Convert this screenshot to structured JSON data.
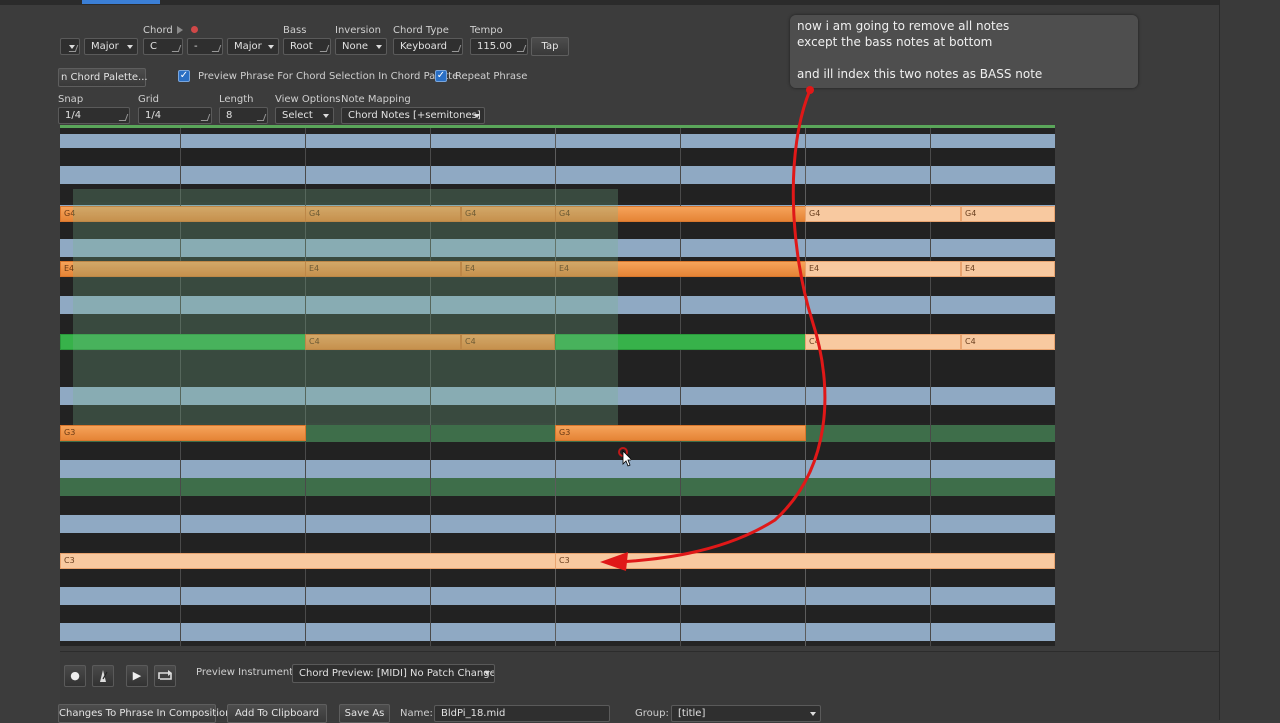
{
  "toolbar": {
    "scale_value": "Major",
    "chord_label": "Chord",
    "chord_value": "C",
    "chord_mod": "-",
    "chord_quality": "Major",
    "bass_label": "Bass",
    "bass_value": "Root",
    "inversion_label": "Inversion",
    "inversion_value": "None",
    "chordtype_label": "Chord Type",
    "chordtype_value": "Keyboard",
    "tempo_label": "Tempo",
    "tempo_value": "115.00",
    "tap_label": "Tap"
  },
  "options": {
    "chord_palette_button": "n Chord Palette...",
    "preview_phrase_label": "Preview Phrase For Chord Selection In Chord Palette",
    "repeat_phrase_label": "Repeat Phrase",
    "check_mark": "✓"
  },
  "grid_controls": {
    "snap_label": "Snap",
    "snap_value": "1/4",
    "grid_label": "Grid",
    "grid_value": "1/4",
    "length_label": "Length",
    "length_value": "8",
    "view_label": "View Options",
    "view_value": "Select",
    "mapping_label": "Note Mapping",
    "mapping_value": "Chord Notes [+semitones]"
  },
  "notes": {
    "g4": "G4",
    "e4": "E4",
    "c4": "C4",
    "g3": "G3",
    "c3": "C3"
  },
  "annotation": {
    "line1": "now i am going to remove all notes",
    "line2": "except the bass notes at bottom",
    "line3": "and ill index this two notes as BASS note"
  },
  "bottom": {
    "preview_instrument_label": "Preview Instrument:",
    "preview_instrument_value": "Chord Preview: [MIDI] No Patch Change",
    "changes_button": "Changes To Phrase In Composition",
    "clipboard_button": "Add To Clipboard",
    "saveas_button": "Save As",
    "name_label": "Name:",
    "name_value": "BldPi_18.mid",
    "group_label": "Group:",
    "group_value": "[title]"
  },
  "colors": {
    "note_orange": "#f6a35a",
    "note_light": "#f8c9a0",
    "note_green": "#37b24a",
    "arrow_red": "#e01818",
    "row_blue": "#8fa9c3"
  }
}
